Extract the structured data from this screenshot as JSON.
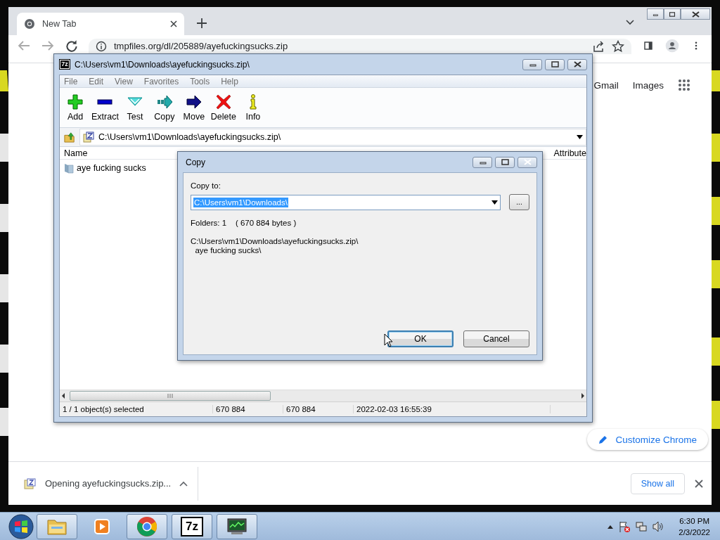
{
  "chrome": {
    "tabs": [
      {
        "label": "New Tab",
        "selected": true
      }
    ],
    "address": "tmpfiles.org/dl/205889/ayefuckingsucks.zip",
    "links": [
      "Gmail",
      "Images"
    ],
    "customize": "Customize Chrome",
    "download": "Opening ayefuckingsucks.zip...",
    "show_all": "Show all"
  },
  "sevenzip": {
    "icon_label": "7z",
    "title": "C:\\Users\\vm1\\Downloads\\ayefuckingsucks.zip\\",
    "menu": [
      "File",
      "Edit",
      "View",
      "Favorites",
      "Tools",
      "Help"
    ],
    "toolbar": [
      {
        "label": "Add",
        "kind": "add"
      },
      {
        "label": "Extract",
        "kind": "extract"
      },
      {
        "label": "Test",
        "kind": "test"
      },
      {
        "label": "Copy",
        "kind": "copy"
      },
      {
        "label": "Move",
        "kind": "move"
      },
      {
        "label": "Delete",
        "kind": "delete"
      },
      {
        "label": "Info",
        "kind": "info"
      }
    ],
    "path": "C:\\Users\\vm1\\Downloads\\ayefuckingsucks.zip\\",
    "columns": [
      "Name",
      "Attribute"
    ],
    "rows": [
      {
        "name": "aye fucking sucks"
      }
    ],
    "status": [
      "1 / 1 object(s) selected",
      "670 884",
      "670 884",
      "2022-02-03 16:55:39"
    ]
  },
  "dialog": {
    "title": "Copy",
    "label": "Copy to:",
    "value": "C:\\Users\\vm1\\Downloads\\",
    "value_selected": true,
    "browse": "...",
    "summary": "Folders: 1    ( 670 884 bytes )",
    "paths": [
      "C:\\Users\\vm1\\Downloads\\ayefuckingsucks.zip\\",
      "  aye fucking sucks\\"
    ],
    "buttons": [
      {
        "label": "OK",
        "default": true
      },
      {
        "label": "Cancel",
        "default": false
      }
    ]
  },
  "taskbar": {
    "apps": [
      {
        "kind": "explorer",
        "running": true
      },
      {
        "kind": "media",
        "running": false
      },
      {
        "kind": "chrome",
        "running": true
      },
      {
        "kind": "sevenzip",
        "running": true,
        "label": "7z"
      },
      {
        "kind": "monitor",
        "running": true
      }
    ],
    "time": "6:30 PM",
    "date": "2/3/2022"
  }
}
